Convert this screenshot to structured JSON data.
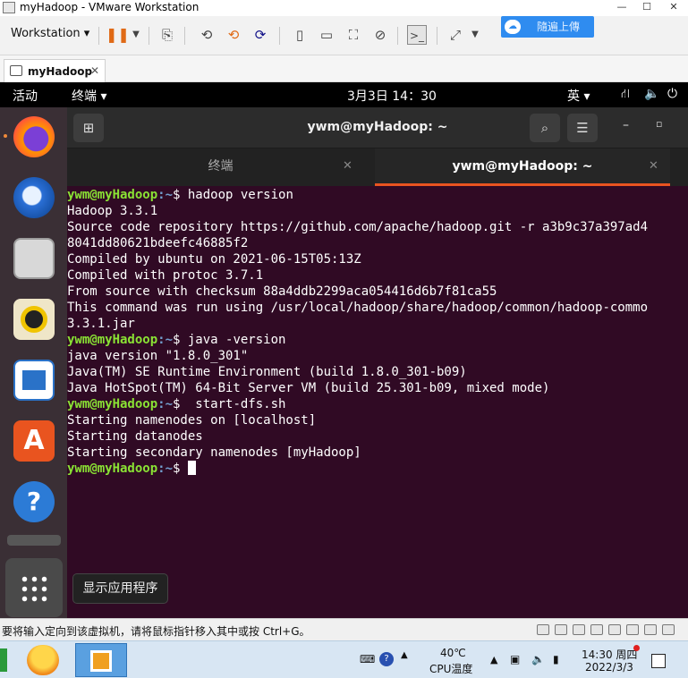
{
  "window": {
    "title": "myHadoop - VMware Workstation"
  },
  "toolbar": {
    "menu_label": "Workstation ▾",
    "cloud_button_label": "隨遍上傳"
  },
  "vm_tab": {
    "label": "myHadoop"
  },
  "ubuntu_topbar": {
    "activities": "活动",
    "app_menu": "终端 ▾",
    "clock": "3月3日  14：30",
    "input_method": "英 ▾"
  },
  "terminal_window": {
    "title": "ywm@myHadoop: ~",
    "tabs": [
      {
        "label": "终端",
        "active": false
      },
      {
        "label": "ywm@myHadoop: ~",
        "active": true
      }
    ]
  },
  "terminal": {
    "prompt_user": "ywm@myHadoop",
    "prompt_path": ":~",
    "lines": [
      {
        "prompt": true,
        "cmd": "$ hadoop version"
      },
      {
        "text": "Hadoop 3.3.1"
      },
      {
        "text": "Source code repository https://github.com/apache/hadoop.git -r a3b9c37a397ad4"
      },
      {
        "text": "8041dd80621bdeefc46885f2"
      },
      {
        "text": "Compiled by ubuntu on 2021-06-15T05:13Z"
      },
      {
        "text": "Compiled with protoc 3.7.1"
      },
      {
        "text": "From source with checksum 88a4ddb2299aca054416d6b7f81ca55"
      },
      {
        "text": "This command was run using /usr/local/hadoop/share/hadoop/common/hadoop-commo"
      },
      {
        "text": "3.3.1.jar"
      },
      {
        "prompt": true,
        "cmd": "$ java -version"
      },
      {
        "text": "java version \"1.8.0_301\""
      },
      {
        "text": "Java(TM) SE Runtime Environment (build 1.8.0_301-b09)"
      },
      {
        "text": "Java HotSpot(TM) 64-Bit Server VM (build 25.301-b09, mixed mode)"
      },
      {
        "prompt": true,
        "cmd": "$  start-dfs.sh"
      },
      {
        "text": "Starting namenodes on [localhost]"
      },
      {
        "text": "Starting datanodes"
      },
      {
        "text": "Starting secondary namenodes [myHadoop]"
      },
      {
        "prompt": true,
        "cmd": "$ ",
        "cursor": true
      }
    ]
  },
  "dock": {
    "tooltip": "显示应用程序",
    "items": [
      "firefox-icon",
      "thunderbird-icon",
      "files-icon",
      "rhythmbox-icon",
      "libreoffice-writer-icon",
      "software-icon",
      "help-icon",
      "show-apps-icon"
    ]
  },
  "vm_status": {
    "message": "要将输入定向到该虚拟机，请将鼠标指针移入其中或按 Ctrl+G。"
  },
  "taskbar": {
    "temperature": "40℃",
    "temperature_label": "CPU温度",
    "time": "14:30 周四",
    "date": "2022/3/3"
  },
  "colors": {
    "terminal_bg": "#300a24",
    "prompt_user": "#8ae234",
    "prompt_path": "#729fcf",
    "tab_accent": "#e95420"
  }
}
